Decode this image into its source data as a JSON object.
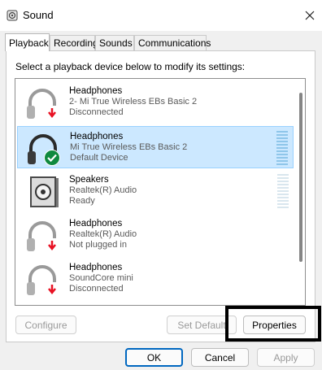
{
  "window": {
    "title": "Sound"
  },
  "tabs": [
    "Playback",
    "Recording",
    "Sounds",
    "Communications"
  ],
  "instruction": "Select a playback device below to modify its settings:",
  "devices": [
    {
      "name": "Headphones",
      "line1": "2- Mi True Wireless EBs Basic 2",
      "line2": "Disconnected",
      "icon": "headphones-icon",
      "status_icon": "disconnected-arrow-icon"
    },
    {
      "name": "Headphones",
      "line1": "Mi True Wireless EBs Basic 2",
      "line2": "Default Device",
      "icon": "headphones-icon",
      "status_icon": "default-check-icon",
      "selected": true
    },
    {
      "name": "Speakers",
      "line1": "Realtek(R) Audio",
      "line2": "Ready",
      "icon": "speaker-icon"
    },
    {
      "name": "Headphones",
      "line1": "Realtek(R) Audio",
      "line2": "Not plugged in",
      "icon": "headphones-icon",
      "status_icon": "disconnected-arrow-icon"
    },
    {
      "name": "Headphones",
      "line1": "SoundCore mini",
      "line2": "Disconnected",
      "icon": "headphones-icon",
      "status_icon": "disconnected-arrow-icon"
    }
  ],
  "buttons": {
    "configure": "Configure",
    "set_default": "Set Default",
    "properties": "Properties",
    "ok": "OK",
    "cancel": "Cancel",
    "apply": "Apply"
  },
  "colors": {
    "selection_bg": "#cce8ff",
    "status_red": "#e81123",
    "status_green": "#10893e",
    "accent": "#0067c0"
  }
}
